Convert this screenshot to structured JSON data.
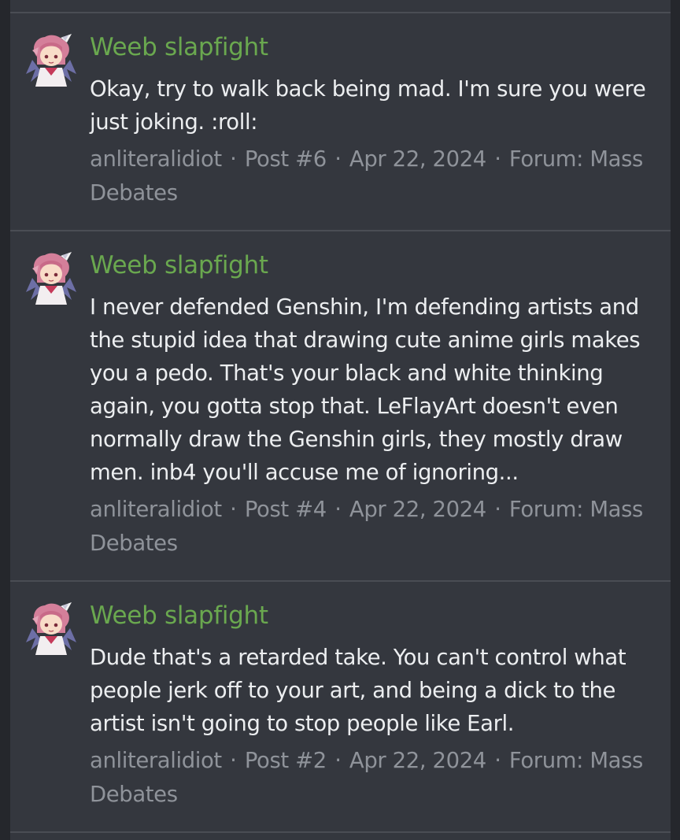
{
  "results": [
    {
      "title": "Weeb slapfight",
      "snippet": "Okay, try to walk back being mad. I'm sure you were just joking. :roll:",
      "author": "anliteralidiot",
      "post": "Post #6",
      "date": "Apr 22, 2024",
      "forum": "Forum: Mass Debates",
      "avatar_icon": "anime-avatar-icon"
    },
    {
      "title": "Weeb slapfight",
      "snippet": "I never defended Genshin, I'm defending artists and the stupid idea that drawing cute anime girls makes you a pedo. That's your black and white thinking again, you gotta stop that. LeFlayArt doesn't even normally draw the Genshin girls, they mostly draw men. inb4 you'll accuse me of ignoring...",
      "author": "anliteralidiot",
      "post": "Post #4",
      "date": "Apr 22, 2024",
      "forum": "Forum: Mass Debates",
      "avatar_icon": "anime-avatar-icon"
    },
    {
      "title": "Weeb slapfight",
      "snippet": "Dude that's a retarded take. You can't control what people jerk off to your art, and being a dick to the artist isn't going to stop people like Earl.",
      "author": "anliteralidiot",
      "post": "Post #2",
      "date": "Apr 22, 2024",
      "forum": "Forum: Mass Debates",
      "avatar_icon": "anime-avatar-icon"
    }
  ],
  "meta_separator": "·",
  "colors": {
    "background": "#25272c",
    "panel": "#34373e",
    "divider": "#4a4d54",
    "title": "#6aa84f",
    "snippet": "#eceef0",
    "meta": "#8f939a"
  }
}
